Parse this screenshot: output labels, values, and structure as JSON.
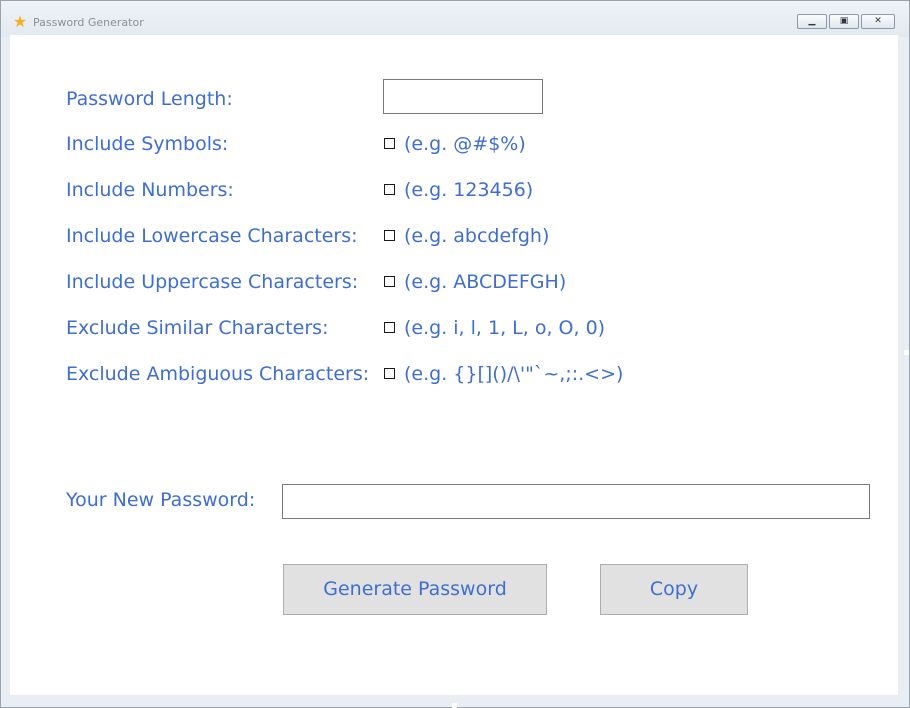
{
  "window": {
    "title": "Password Generator",
    "icon": "star-icon",
    "controls": {
      "minimize": "minimize-icon",
      "maximize": "maximize-icon",
      "close": "close-icon"
    }
  },
  "form": {
    "length_label": "Password Length:",
    "length_value": "",
    "options": [
      {
        "label": "Include Symbols:",
        "example": "(e.g. @#$%)",
        "checked": false
      },
      {
        "label": "Include Numbers:",
        "example": "(e.g. 123456)",
        "checked": false
      },
      {
        "label": "Include Lowercase Characters:",
        "example": "(e.g. abcdefgh)",
        "checked": false
      },
      {
        "label": "Include Uppercase Characters:",
        "example": "(e.g. ABCDEFGH)",
        "checked": false
      },
      {
        "label": "Exclude Similar Characters:",
        "example": "(e.g. i, l, 1, L, o, O, 0)",
        "checked": false
      },
      {
        "label": "Exclude Ambiguous Characters:",
        "example": "(e.g. {}[]()/\\'\"`~,;:.<>)",
        "checked": false
      }
    ],
    "new_password_label": "Your New Password:",
    "new_password_value": ""
  },
  "buttons": {
    "generate": "Generate Password",
    "copy": "Copy"
  },
  "colors": {
    "label_text": "#3f6ecf",
    "button_bg": "#e1e1e1",
    "client_bg": "#ffffff"
  }
}
